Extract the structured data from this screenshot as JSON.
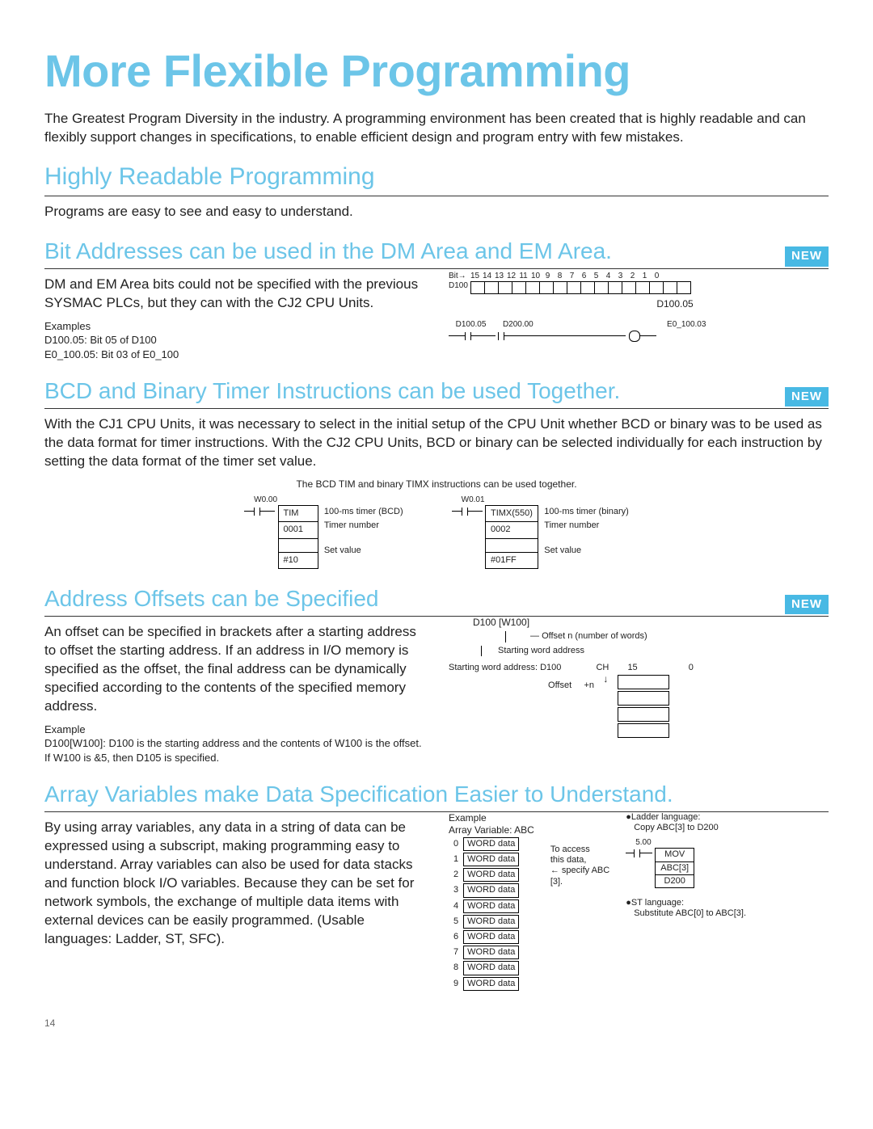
{
  "page_number": "14",
  "title": "More Flexible Programming",
  "intro": "The Greatest Program Diversity in the industry. A programming environment has been created that is highly readable and can flexibly support changes in specifications, to enable efficient design and program entry with few mistakes.",
  "badges": {
    "new": "NEW"
  },
  "sec1": {
    "heading": "Highly Readable Programming",
    "body": "Programs are easy to see and easy to understand."
  },
  "sec2": {
    "heading": "Bit Addresses can be used in the DM Area and EM Area.",
    "body": "DM and EM Area bits could not be specified with the previous SYSMAC PLCs, but they can with the CJ2 CPU Units.",
    "examples_label": "Examples",
    "example1": "D100.05: Bit 05 of D100",
    "example2": "E0_100.05: Bit 03 of E0_100",
    "bit_arrow": "Bit→",
    "row_label": "D100",
    "bits": [
      "15",
      "14",
      "13",
      "12",
      "11",
      "10",
      "9",
      "8",
      "7",
      "6",
      "5",
      "4",
      "3",
      "2",
      "1",
      "0"
    ],
    "callout": "D100.05",
    "ladder": {
      "c1": "D100.05",
      "c2": "D200.00",
      "coil": "E0_100.03"
    }
  },
  "sec3": {
    "heading": "BCD and Binary Timer Instructions can be used Together.",
    "body": "With the CJ1 CPU Units, it was necessary to select in the initial setup of the CPU Unit whether BCD or binary was to be used as the data format for timer instructions. With the CJ2 CPU Units, BCD or binary can be selected individually for each instruction by setting the data format of the timer set value.",
    "center_note": "The BCD TIM and binary TIMX instructions can be used together.",
    "left": {
      "contact": "W0.00",
      "name": "TIM",
      "p1": "0001",
      "p2": "#10",
      "d1": "100-ms timer (BCD)",
      "d2": "Timer number",
      "d3": "Set value"
    },
    "right": {
      "contact": "W0.01",
      "name": "TIMX(550)",
      "p1": "0002",
      "p2": "#01FF",
      "d1": "100-ms timer (binary)",
      "d2": "Timer number",
      "d3": "Set value"
    }
  },
  "sec4": {
    "heading": "Address Offsets can be Specified",
    "body": "An offset can be specified in brackets after a starting address to offset the starting address. If an address in I/O memory is specified as the offset, the final address can be dynamically specified according to the contents of the specified memory address.",
    "example_label": "Example",
    "example_text": "D100[W100]: D100 is the starting address and the contents of W100 is the offset. If W100 is &5, then D105 is specified.",
    "diagram": {
      "expr": "D100 [W100]",
      "note1": "Offset n (number of words)",
      "note2": "Starting word address",
      "row_label": "Starting word address: D100",
      "ch": "CH",
      "b15": "15",
      "b0": "0",
      "offset": "Offset",
      "plus_n": "+n"
    }
  },
  "sec5": {
    "heading": "Array Variables make Data Specification Easier to Understand.",
    "body": "By using array variables, any data in a string of data can be expressed using a subscript, making programming easy to understand. Array variables can also be used for data stacks and function block I/O variables. Because they can be set for network symbols, the exchange of multiple data items with external devices can be easily programmed. (Usable languages: Ladder, ST, SFC).",
    "example_label": "Example",
    "var_label": "Array Variable: ABC",
    "cell": "WORD data",
    "indices": [
      "0",
      "1",
      "2",
      "3",
      "4",
      "5",
      "6",
      "7",
      "8",
      "9"
    ],
    "side_note_l1": "To access",
    "side_note_l2": "this data,",
    "side_note_l3": "specify ABC",
    "side_note_l4": "[3].",
    "ladder_label": "●Ladder language:",
    "ladder_text": "Copy ABC[3] to D200",
    "contact": "5.00",
    "mov": {
      "name": "MOV",
      "p1": "ABC[3]",
      "p2": "D200"
    },
    "st_label": "●ST language:",
    "st_text": "Substitute ABC[0] to ABC[3]."
  }
}
